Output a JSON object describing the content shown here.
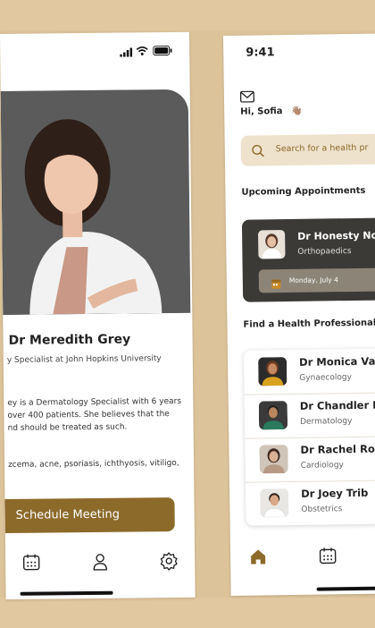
{
  "left_screen": {
    "doctor_name": "Dr Meredith Grey",
    "doctor_title": "y Specialist at John Hopkins University",
    "bio_line1": "ey is a Dermatology Specialist with 6 years",
    "bio_line2": " over 400 patients. She believes that the",
    "bio_line3": "nd should be treated as such.",
    "conditions": "zcema, acne, psoriasis, ichthyosis, vitiligo,",
    "schedule_button": "Schedule Meeting",
    "nav_icons": [
      "calendar-icon",
      "person-icon",
      "gear-icon"
    ]
  },
  "right_screen": {
    "status_time": "9:41",
    "greeting": "Hi, Sofia",
    "greeting_emoji": "👋🏽",
    "search_placeholder": "Search for a health pr",
    "upcoming_heading": "Upcoming Appointments",
    "appointment": {
      "doctor": "Dr Honesty Noah",
      "specialty": "Orthopaedics",
      "date": "Monday, July 4"
    },
    "find_heading": "Find a Health Professional",
    "professionals": [
      {
        "name": "Dr Monica Vasqu",
        "specialty": "Gynaecology"
      },
      {
        "name": "Dr Chandler Bing",
        "specialty": "Dermatology"
      },
      {
        "name": "Dr Rachel Ross",
        "specialty": "Cardiology"
      },
      {
        "name": "Dr Joey Trib",
        "specialty": "Obstetrics"
      }
    ]
  },
  "colors": {
    "background": "#dcc39a",
    "accent_brown": "#8c6a2a",
    "card_dark": "#3b3a36",
    "search_bg": "#efe2cc"
  }
}
